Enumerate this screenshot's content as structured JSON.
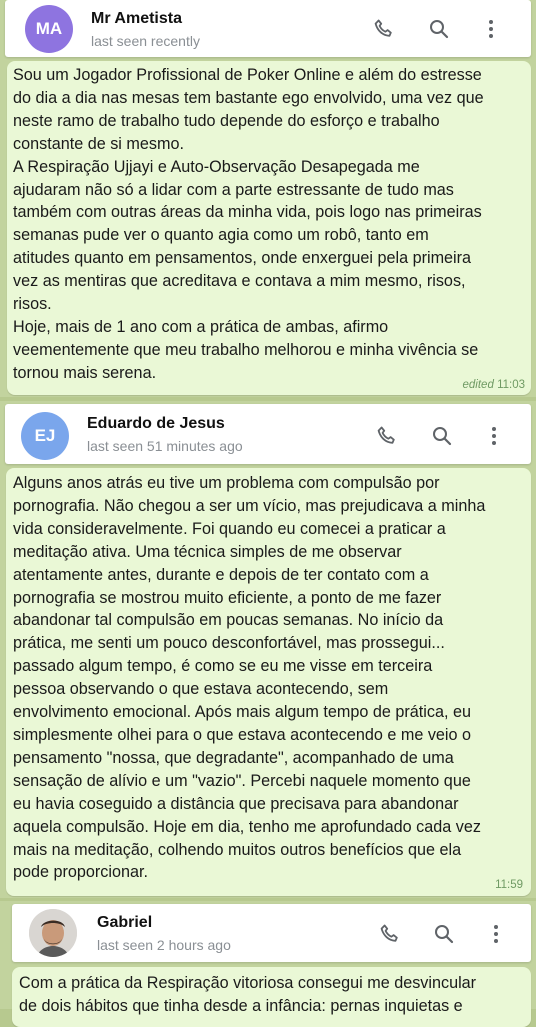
{
  "chats": [
    {
      "contact": {
        "initials": "MA",
        "name": "Mr Ametista",
        "status": "last seen recently",
        "avatar_color": "#8e74e0"
      },
      "message": {
        "text": "Sou um Jogador Profissional de Poker Online e além do estresse\ndo dia a dia nas mesas tem bastante ego envolvido, uma vez que\nneste ramo de trabalho tudo depende do esforço e trabalho\nconstante de si mesmo.\nA Respiração Ujjayi e Auto-Observação Desapegada me\najudaram não só a lidar com a parte estressante de tudo mas\ntambém com outras áreas da minha vida, pois logo nas primeiras\nsemanas pude ver o quanto agia como um robô, tanto em\natitudes quanto em pensamentos, onde enxerguei pela primeira\nvez as mentiras que acreditava e contava a mim mesmo, risos,\nrisos.\nHoje, mais de 1 ano com a prática de ambas, afirmo\nveementemente que meu trabalho melhorou e minha vivência se\ntornou mais serena.",
        "edited_label": "edited",
        "time": "11:03"
      }
    },
    {
      "contact": {
        "initials": "EJ",
        "name": "Eduardo de Jesus",
        "status": "last seen 51 minutes ago",
        "avatar_color": "#7aa6ec"
      },
      "message": {
        "text": "Alguns anos atrás eu tive um problema com compulsão por\npornografia. Não chegou a ser um vício, mas prejudicava a minha\nvida consideravelmente. Foi quando eu comecei a praticar a\nmeditação ativa. Uma técnica simples de me observar\natentamente antes, durante e depois de ter contato com a\npornografia se mostrou muito eficiente, a ponto de me fazer\nabandonar tal compulsão em poucas semanas. No início da\nprática, me senti um pouco desconfortável, mas prossegui...\npassado algum tempo, é como se eu me visse em terceira\npessoa observando o que estava acontecendo, sem\nenvolvimento emocional. Após mais algum tempo de prática, eu\nsimplesmente olhei para o que estava acontecendo e me veio o\npensamento \"nossa, que degradante\", acompanhado de uma\nsensação de alívio e um \"vazio\". Percebi naquele momento que\neu havia coseguido a distância que precisava para abandonar\naquela compulsão. Hoje em dia, tenho me aprofundado cada vez\nmais na meditação, colhendo muitos outros benefícios que ela\npode proporcionar.",
        "time": "11:59"
      }
    },
    {
      "contact": {
        "name": "Gabriel",
        "status": "last seen 2 hours ago"
      },
      "message": {
        "text": "Com a prática da Respiração vitoriosa consegui me desvincular\nde dois hábitos que tinha desde a infância: pernas inquietas e"
      }
    }
  ],
  "icons": {
    "call": "phone-icon",
    "search": "search-icon",
    "menu": "more-vertical-icon"
  },
  "colors": {
    "background": "#c2d39e",
    "bubble": "#eaf8d6",
    "meta": "#6f9a63",
    "header": "#ffffff"
  }
}
